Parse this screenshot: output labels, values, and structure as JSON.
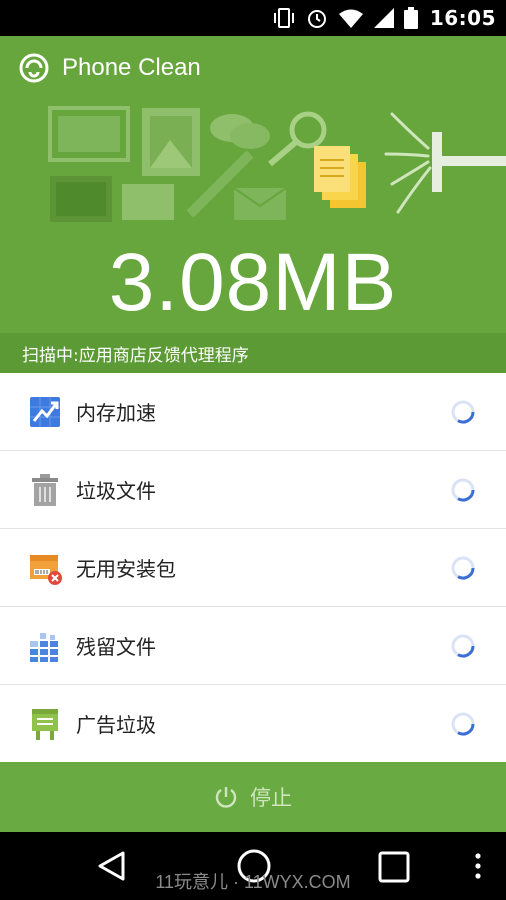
{
  "status_bar": {
    "time": "16:05"
  },
  "app": {
    "title": "Phone Clean"
  },
  "scan": {
    "size": "3.08MB",
    "status_text": "扫描中:应用商店反馈代理程序"
  },
  "items": [
    {
      "label": "内存加速",
      "icon": "memory-boost-icon"
    },
    {
      "label": "垃圾文件",
      "icon": "trash-icon"
    },
    {
      "label": "无用安装包",
      "icon": "package-icon"
    },
    {
      "label": "残留文件",
      "icon": "residual-files-icon"
    },
    {
      "label": "广告垃圾",
      "icon": "ad-junk-icon"
    }
  ],
  "stop_button": {
    "label": "停止"
  },
  "watermark": "11玩意儿 · 11WYX.COM",
  "colors": {
    "header": "#66a63d",
    "strip": "#5b9a34",
    "button": "#6aaa43",
    "spinner": "#3b6fd6"
  }
}
